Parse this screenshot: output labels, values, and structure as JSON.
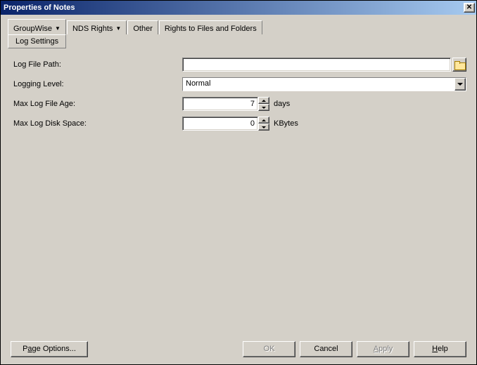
{
  "title": "Properties of Notes",
  "close_glyph": "✕",
  "tabs": {
    "groupwise": "GroupWise",
    "nds_rights": "NDS Rights",
    "other": "Other",
    "rights_files": "Rights to Files and Folders"
  },
  "subtab": "Log Settings",
  "form": {
    "log_file_path": {
      "label": "Log File Path:",
      "value": ""
    },
    "logging_level": {
      "label": "Logging Level:",
      "value": "Normal"
    },
    "max_log_file_age": {
      "label": "Max Log File Age:",
      "value": "7",
      "unit": "days"
    },
    "max_log_disk_space": {
      "label": "Max Log Disk Space:",
      "value": "0",
      "unit": "KBytes"
    }
  },
  "buttons": {
    "page_options_pre": "P",
    "page_options_mn": "a",
    "page_options_post": "ge Options...",
    "ok": "OK",
    "cancel": "Cancel",
    "apply_mn": "A",
    "apply_post": "pply",
    "help_mn": "H",
    "help_post": "elp"
  }
}
